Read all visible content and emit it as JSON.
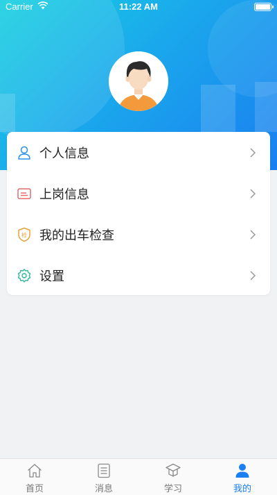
{
  "status_bar": {
    "carrier": "Carrier",
    "time": "11:22 AM"
  },
  "menu": {
    "items": [
      {
        "label": "个人信息",
        "icon": "user-icon"
      },
      {
        "label": "上岗信息",
        "icon": "id-card-icon"
      },
      {
        "label": "我的出车检查",
        "icon": "inspection-shield-icon",
        "badge": "检"
      },
      {
        "label": "设置",
        "icon": "gear-icon"
      }
    ]
  },
  "tabbar": {
    "items": [
      {
        "label": "首页",
        "icon": "home-icon",
        "active": false
      },
      {
        "label": "消息",
        "icon": "message-list-icon",
        "active": false
      },
      {
        "label": "学习",
        "icon": "graduation-cap-icon",
        "active": false
      },
      {
        "label": "我的",
        "icon": "profile-icon",
        "active": true
      }
    ]
  },
  "colors": {
    "accent": "#1a7ff0",
    "header_start": "#17d0e0",
    "header_end": "#1a7ff0"
  }
}
